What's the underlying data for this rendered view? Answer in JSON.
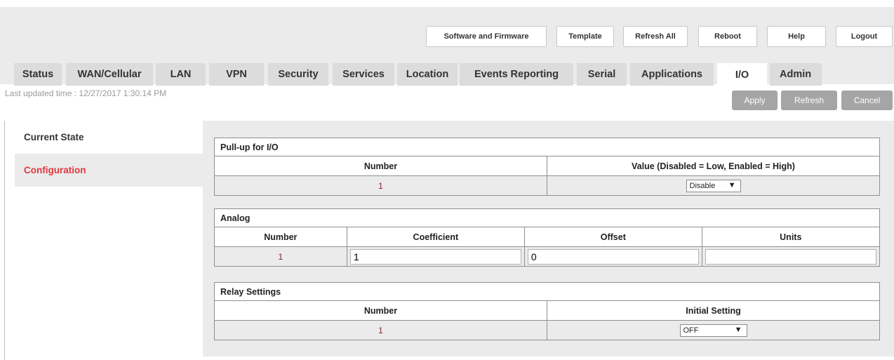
{
  "top_buttons": [
    "Software and Firmware",
    "Template",
    "Refresh All",
    "Reboot",
    "Help",
    "Logout"
  ],
  "tabs": [
    "Status",
    "WAN/Cellular",
    "LAN",
    "VPN",
    "Security",
    "Services",
    "Location",
    "Events Reporting",
    "Serial",
    "Applications",
    "I/O",
    "Admin"
  ],
  "active_tab": "I/O",
  "last_updated": "Last updated time : 12/27/2017 1:30:14 PM",
  "actions": {
    "apply": "Apply",
    "refresh": "Refresh",
    "cancel": "Cancel"
  },
  "sidebar": {
    "items": [
      "Current State",
      "Configuration"
    ],
    "selected": "Configuration"
  },
  "pullup": {
    "title": "Pull-up for I/O",
    "headers": [
      "Number",
      "Value (Disabled = Low, Enabled = High)"
    ],
    "number": "1",
    "value": "Disable"
  },
  "analog": {
    "title": "Analog",
    "headers": [
      "Number",
      "Coefficient",
      "Offset",
      "Units"
    ],
    "number": "1",
    "coefficient": "1",
    "offset": "0",
    "units": ""
  },
  "relay": {
    "title": "Relay Settings",
    "headers": [
      "Number",
      "Initial Setting"
    ],
    "number": "1",
    "initial_setting": "OFF"
  },
  "colors": {
    "accent_red": "#e0383e",
    "button_grey": "#a5a5a5",
    "panel_grey": "#ebebeb"
  }
}
